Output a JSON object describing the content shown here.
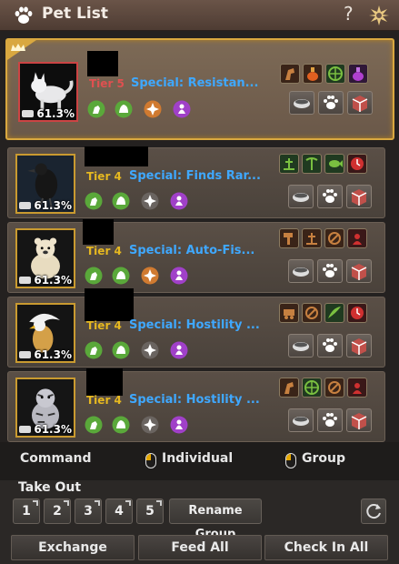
{
  "window": {
    "title": "Pet List",
    "help_glyph": "?"
  },
  "pets": [
    {
      "tier": "Tier 5",
      "special": "Special: Resistan...",
      "exp": "61.3%",
      "tier_color": "#e05050"
    },
    {
      "tier": "Tier 4",
      "special": "Special: Finds Rar...",
      "exp": "61.3%",
      "tier_color": "#e6b820"
    },
    {
      "tier": "Tier 4",
      "special": "Special: Auto-Fis...",
      "exp": "61.3%",
      "tier_color": "#e6b820"
    },
    {
      "tier": "Tier 4",
      "special": "Special: Hostility ...",
      "exp": "61.3%",
      "tier_color": "#e6b820"
    },
    {
      "tier": "Tier 4",
      "special": "Special: Hostility ...",
      "exp": "61.3%",
      "tier_color": "#e6b820"
    }
  ],
  "commands": {
    "command": "Command",
    "individual": "Individual",
    "group": "Group"
  },
  "take_out": {
    "label": "Take Out",
    "slots": [
      "1",
      "2",
      "3",
      "4",
      "5"
    ],
    "rename": "Rename Group"
  },
  "actions": {
    "exchange": "Exchange",
    "feed_all": "Feed All",
    "check_in_all": "Check In All"
  },
  "colors": {
    "special_text": "#3fa8ff",
    "selected_border": "#d9a840",
    "skill_green": "#5aa83a",
    "skill_orange": "#d07a30",
    "skill_purple": "#a040c8",
    "skill_gray": "#6a6460"
  }
}
